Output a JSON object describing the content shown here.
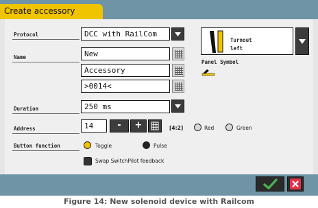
{
  "window": {
    "title": "Create accessory"
  },
  "protocol": {
    "label": "Protocol",
    "value": "DCC with RailCom"
  },
  "name": {
    "label": "Name",
    "line1": "New",
    "line2": "Accessory",
    "line3": ">0014<"
  },
  "duration": {
    "label": "Duration",
    "value": "250 ms"
  },
  "address": {
    "label": "Address",
    "value": "14",
    "minus": "-",
    "plus": "+",
    "port_info": "[4:2]",
    "red": "Red",
    "green": "Green"
  },
  "button_function": {
    "label": "Button function",
    "toggle": "Toggle",
    "pulse": "Pulse",
    "selected": "Toggle"
  },
  "swap": {
    "label": "Swap SwitchPilot feedback",
    "checked": false
  },
  "symbol": {
    "line1": "Turnout",
    "line2": "left",
    "panel_label": "Panel Symbol"
  },
  "caption": "Figure 14: New solenoid device with Railcom",
  "colors": {
    "accent_tab": "#f0c400",
    "bar": "#6f94a6",
    "ok": "#4caf50",
    "cancel": "#e0334a"
  }
}
